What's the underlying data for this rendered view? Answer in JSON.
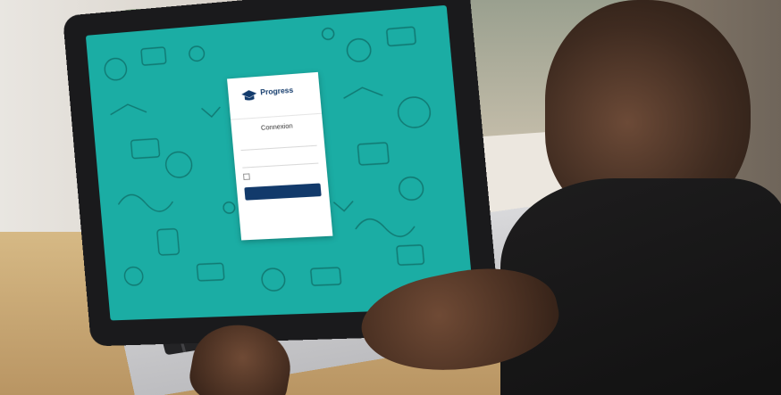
{
  "photo": {
    "description_free": true,
    "login_card": {
      "logo_text": "Progress",
      "title": "Connexion"
    },
    "colors": {
      "screen_teal": "#1bada4",
      "brand_navy": "#123a6b"
    }
  }
}
